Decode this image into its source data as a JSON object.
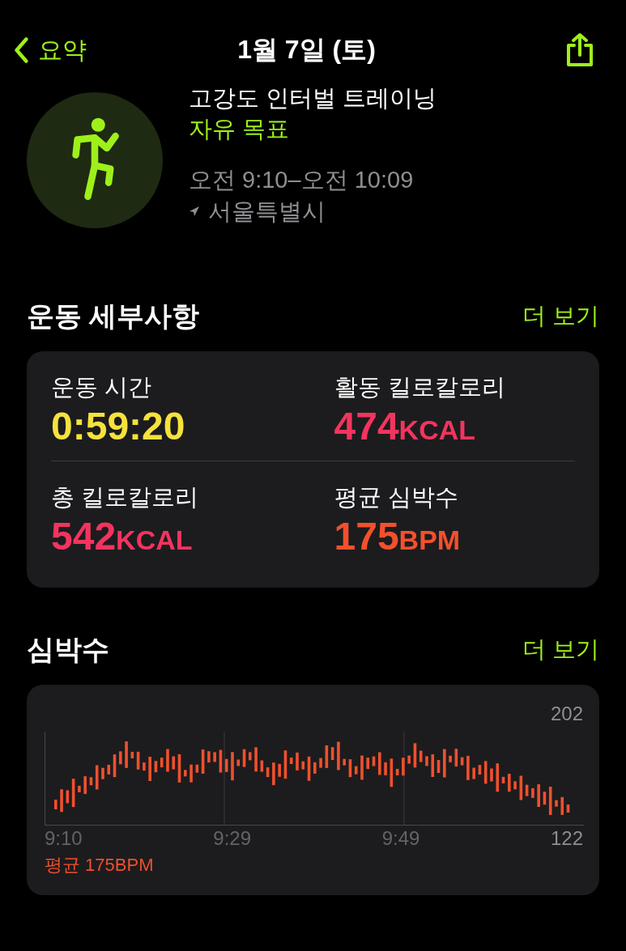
{
  "nav": {
    "back_label": "요약",
    "title": "1월 7일 (토)"
  },
  "workout": {
    "name": "고강도 인터벌 트레이닝",
    "goal": "자유 목표",
    "time_range": "오전 9:10–오전 10:09",
    "location": "서울특별시"
  },
  "details": {
    "title": "운동 세부사항",
    "more": "더 보기",
    "metrics": [
      {
        "label": "운동 시간",
        "value": "0:59:20",
        "color": "#f5e23c"
      },
      {
        "label": "활동 킬로칼로리",
        "value": "474",
        "unit": "KCAL",
        "color": "#f2345e"
      },
      {
        "label": "총 킬로칼로리",
        "value": "542",
        "unit": "KCAL",
        "color": "#f2345e"
      },
      {
        "label": "평균 심박수",
        "value": "175",
        "unit": "BPM",
        "color": "#f4502c"
      }
    ]
  },
  "heart_rate": {
    "title": "심박수",
    "more": "더 보기",
    "y_max": "202",
    "y_min": "122",
    "x_labels": [
      "9:10",
      "9:29",
      "9:49"
    ],
    "average": "평균 175BPM"
  }
}
